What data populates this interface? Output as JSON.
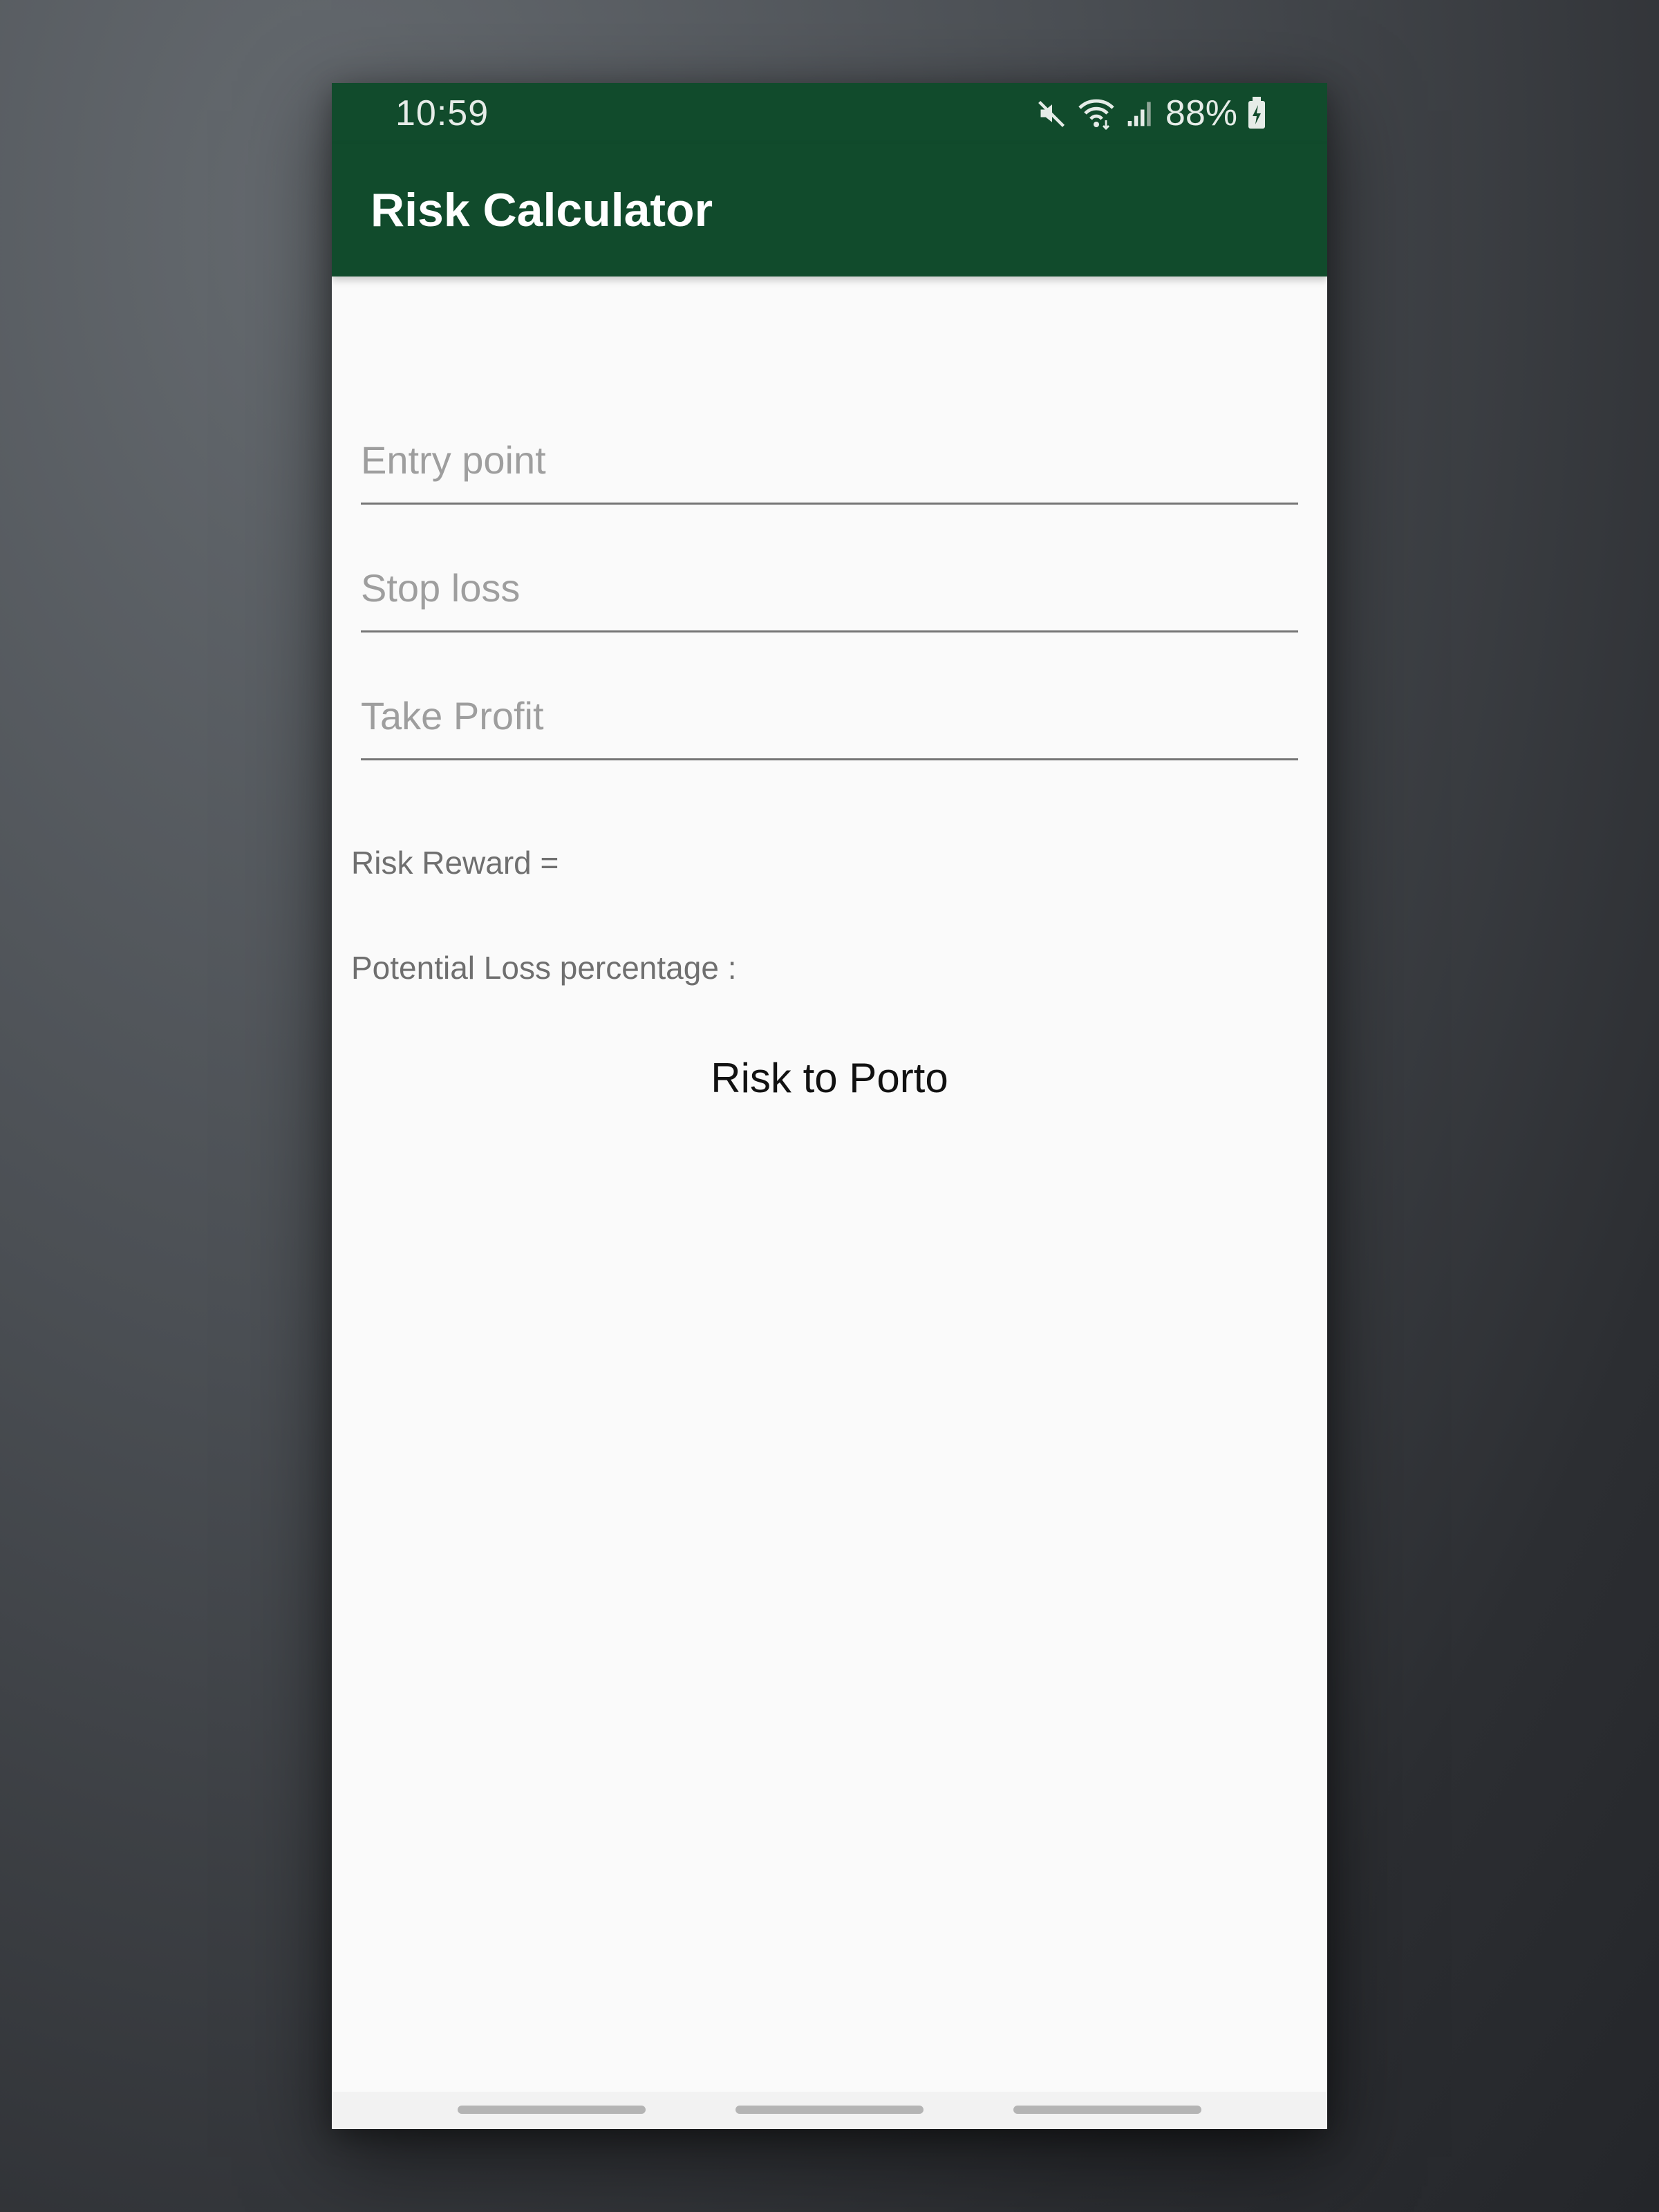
{
  "status_bar": {
    "time": "10:59",
    "battery": "88%",
    "icons": [
      "mute-icon",
      "wifi-icon",
      "signal-icon",
      "battery-charging-icon"
    ]
  },
  "app_bar": {
    "title": "Risk Calculator"
  },
  "form": {
    "entry_point": {
      "placeholder": "Entry point",
      "value": ""
    },
    "stop_loss": {
      "placeholder": "Stop loss",
      "value": ""
    },
    "take_profit": {
      "placeholder": "Take Profit",
      "value": ""
    }
  },
  "results": {
    "risk_reward": "Risk Reward =",
    "potential_loss": "Potential Loss percentage :"
  },
  "actions": {
    "risk_to_porto": "Risk to Porto"
  },
  "colors": {
    "primary": "#114b2c",
    "background": "#fafafa",
    "hint": "#9e9e9e",
    "label": "#6f6f6f"
  }
}
